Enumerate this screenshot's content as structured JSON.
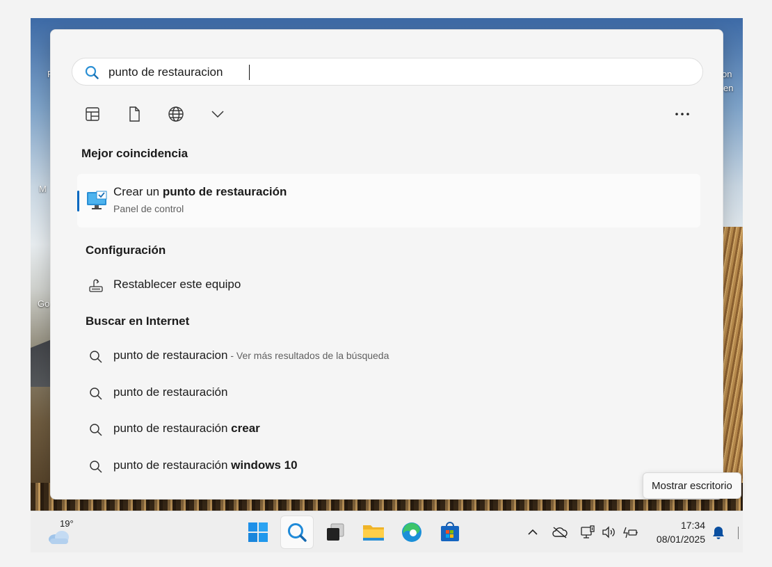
{
  "desktop": {
    "labels": [
      "P",
      "on",
      "en",
      "M",
      "Go"
    ]
  },
  "search": {
    "query": "punto de restauracion",
    "placeholder": ""
  },
  "filters": {
    "items": [
      {
        "icon": "apps-icon"
      },
      {
        "icon": "document-icon"
      },
      {
        "icon": "web-icon"
      },
      {
        "icon": "chevron-down-icon"
      }
    ],
    "more_icon": "more-options-icon"
  },
  "best_match": {
    "title": "Mejor coincidencia",
    "name_prefix": "Crear un ",
    "name_bold": "punto de restauración",
    "subtitle": "Panel de control"
  },
  "settings": {
    "title": "Configuración",
    "items": [
      {
        "label": "Restablecer este equipo"
      }
    ]
  },
  "web": {
    "title": "Buscar en Internet",
    "items": [
      {
        "text": "punto de restauracion",
        "bold": "",
        "suffix": " - Ver más resultados de la búsqueda"
      },
      {
        "text": "punto de restauración",
        "bold": "",
        "suffix": ""
      },
      {
        "text": "punto de restauración ",
        "bold": "crear",
        "suffix": ""
      },
      {
        "text": "punto de restauración ",
        "bold": "windows 10",
        "suffix": ""
      }
    ]
  },
  "tooltip": "Mostrar escritorio",
  "taskbar": {
    "weather_temp": "19°",
    "apps": [
      "windows-start",
      "search",
      "task-view",
      "file-explorer",
      "edge",
      "microsoft-store"
    ],
    "time": "17:34",
    "date": "08/01/2025"
  },
  "colors": {
    "accent": "#0067c0",
    "search_icon": "#2a8fd4"
  }
}
